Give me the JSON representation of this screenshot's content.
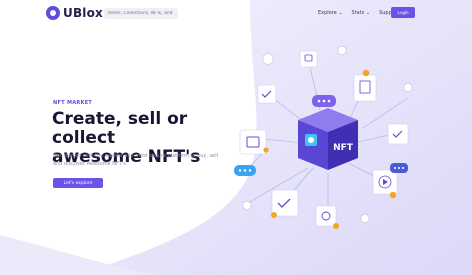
{
  "header": {
    "logo_text": "UBlox",
    "search_placeholder": "Items, Collections, NFTs, and",
    "nav": [
      "Explore ⌄",
      "Stats ⌄",
      "Supports ⌄"
    ],
    "login_label": "Login"
  },
  "hero": {
    "eyebrow": "NFT MARKET",
    "title_line1": "Create, sell or collect",
    "title_line2": "awesome NFT's",
    "description": "Get started with the easiest and most secure platform to buy, sell and discover Awesome NFT's",
    "cta_label": "Let's explore"
  },
  "illustration": {
    "center_label": "NFT",
    "icons": [
      "check-card-icon",
      "image-card-icon",
      "play-card-icon",
      "document-card-icon",
      "chat-bubble-icon",
      "cube-icon",
      "coin-icon"
    ]
  },
  "colors": {
    "accent": "#6a53e6",
    "dark": "#161733",
    "wave": "#d9d6f7"
  }
}
